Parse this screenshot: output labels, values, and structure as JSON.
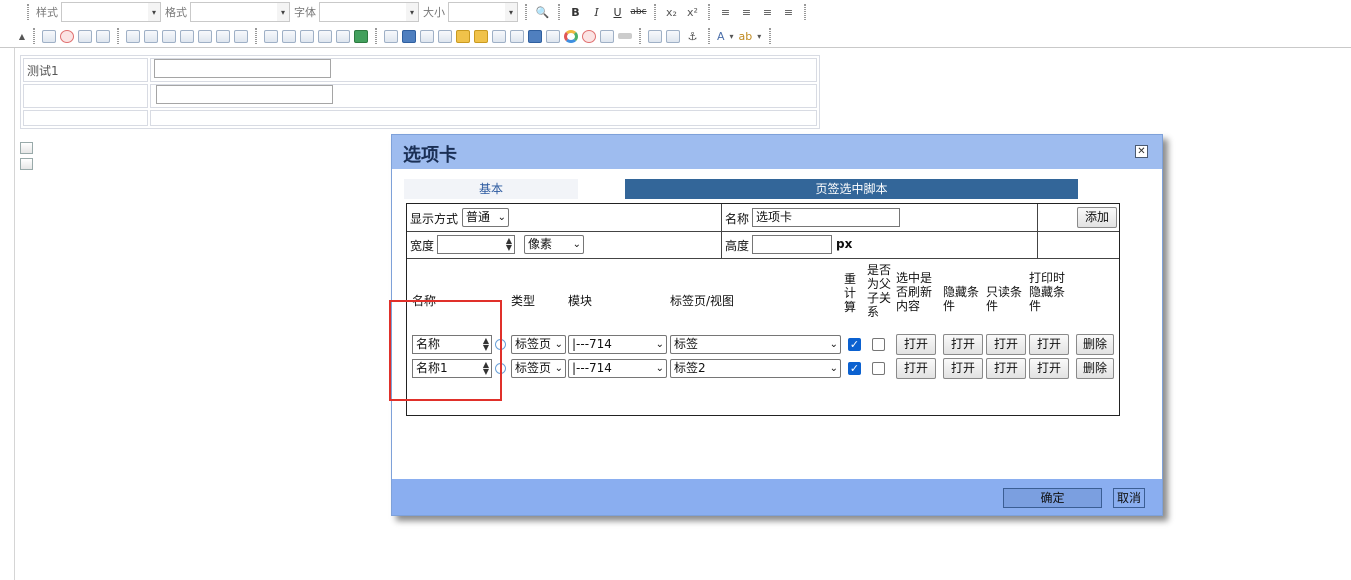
{
  "toolbar": {
    "style_label": "样式",
    "format_label": "格式",
    "font_label": "字体",
    "size_label": "大小",
    "bold": "B",
    "italic": "I",
    "underline": "U",
    "strike": "abc",
    "subscript": "x₂",
    "superscript": "x²",
    "text_color": "A",
    "bg_color": "ab"
  },
  "editor": {
    "rows": [
      {
        "label": "测试1"
      },
      {
        "label": ""
      },
      {
        "label": ""
      }
    ]
  },
  "dialog": {
    "title": "选项卡",
    "close_icon": "close-x",
    "tabs": [
      "基本",
      "页签选中脚本"
    ],
    "display_mode_label": "显示方式",
    "display_mode_value": "普通",
    "name_label": "名称",
    "name_value": "选项卡",
    "add_button": "添加",
    "width_label": "宽度",
    "width_value": "",
    "width_unit": "像素",
    "height_label": "高度",
    "height_value": "",
    "height_unit": "px",
    "columns": {
      "name": "名称",
      "type": "类型",
      "module": "模块",
      "tabview": "标签页/视图",
      "recalc": "重计算",
      "is_parent": "是否为父子关系",
      "refresh": "选中是否刷新内容",
      "hide_cond": "隐藏条件",
      "readonly_cond": "只读条件",
      "print_hide_cond": "打印时隐藏条件"
    },
    "rows": [
      {
        "name": "名称",
        "type": "标签页",
        "module": "|---714",
        "tabview": "标签",
        "recalc": true,
        "is_parent": false,
        "open1": "打开",
        "open2": "打开",
        "open3": "打开",
        "open4": "打开",
        "delete": "删除"
      },
      {
        "name": "名称1",
        "type": "标签页",
        "module": "|---714",
        "tabview": "标签2",
        "recalc": true,
        "is_parent": false,
        "open1": "打开",
        "open2": "打开",
        "open3": "打开",
        "open4": "打开",
        "delete": "删除"
      }
    ],
    "ok_button": "确定",
    "cancel_button": "取消"
  },
  "colors": {
    "title_bar": "#9ebcef",
    "footer": "#8aaef0",
    "active_tab": "#336699",
    "highlight_box": "#e0302a"
  }
}
